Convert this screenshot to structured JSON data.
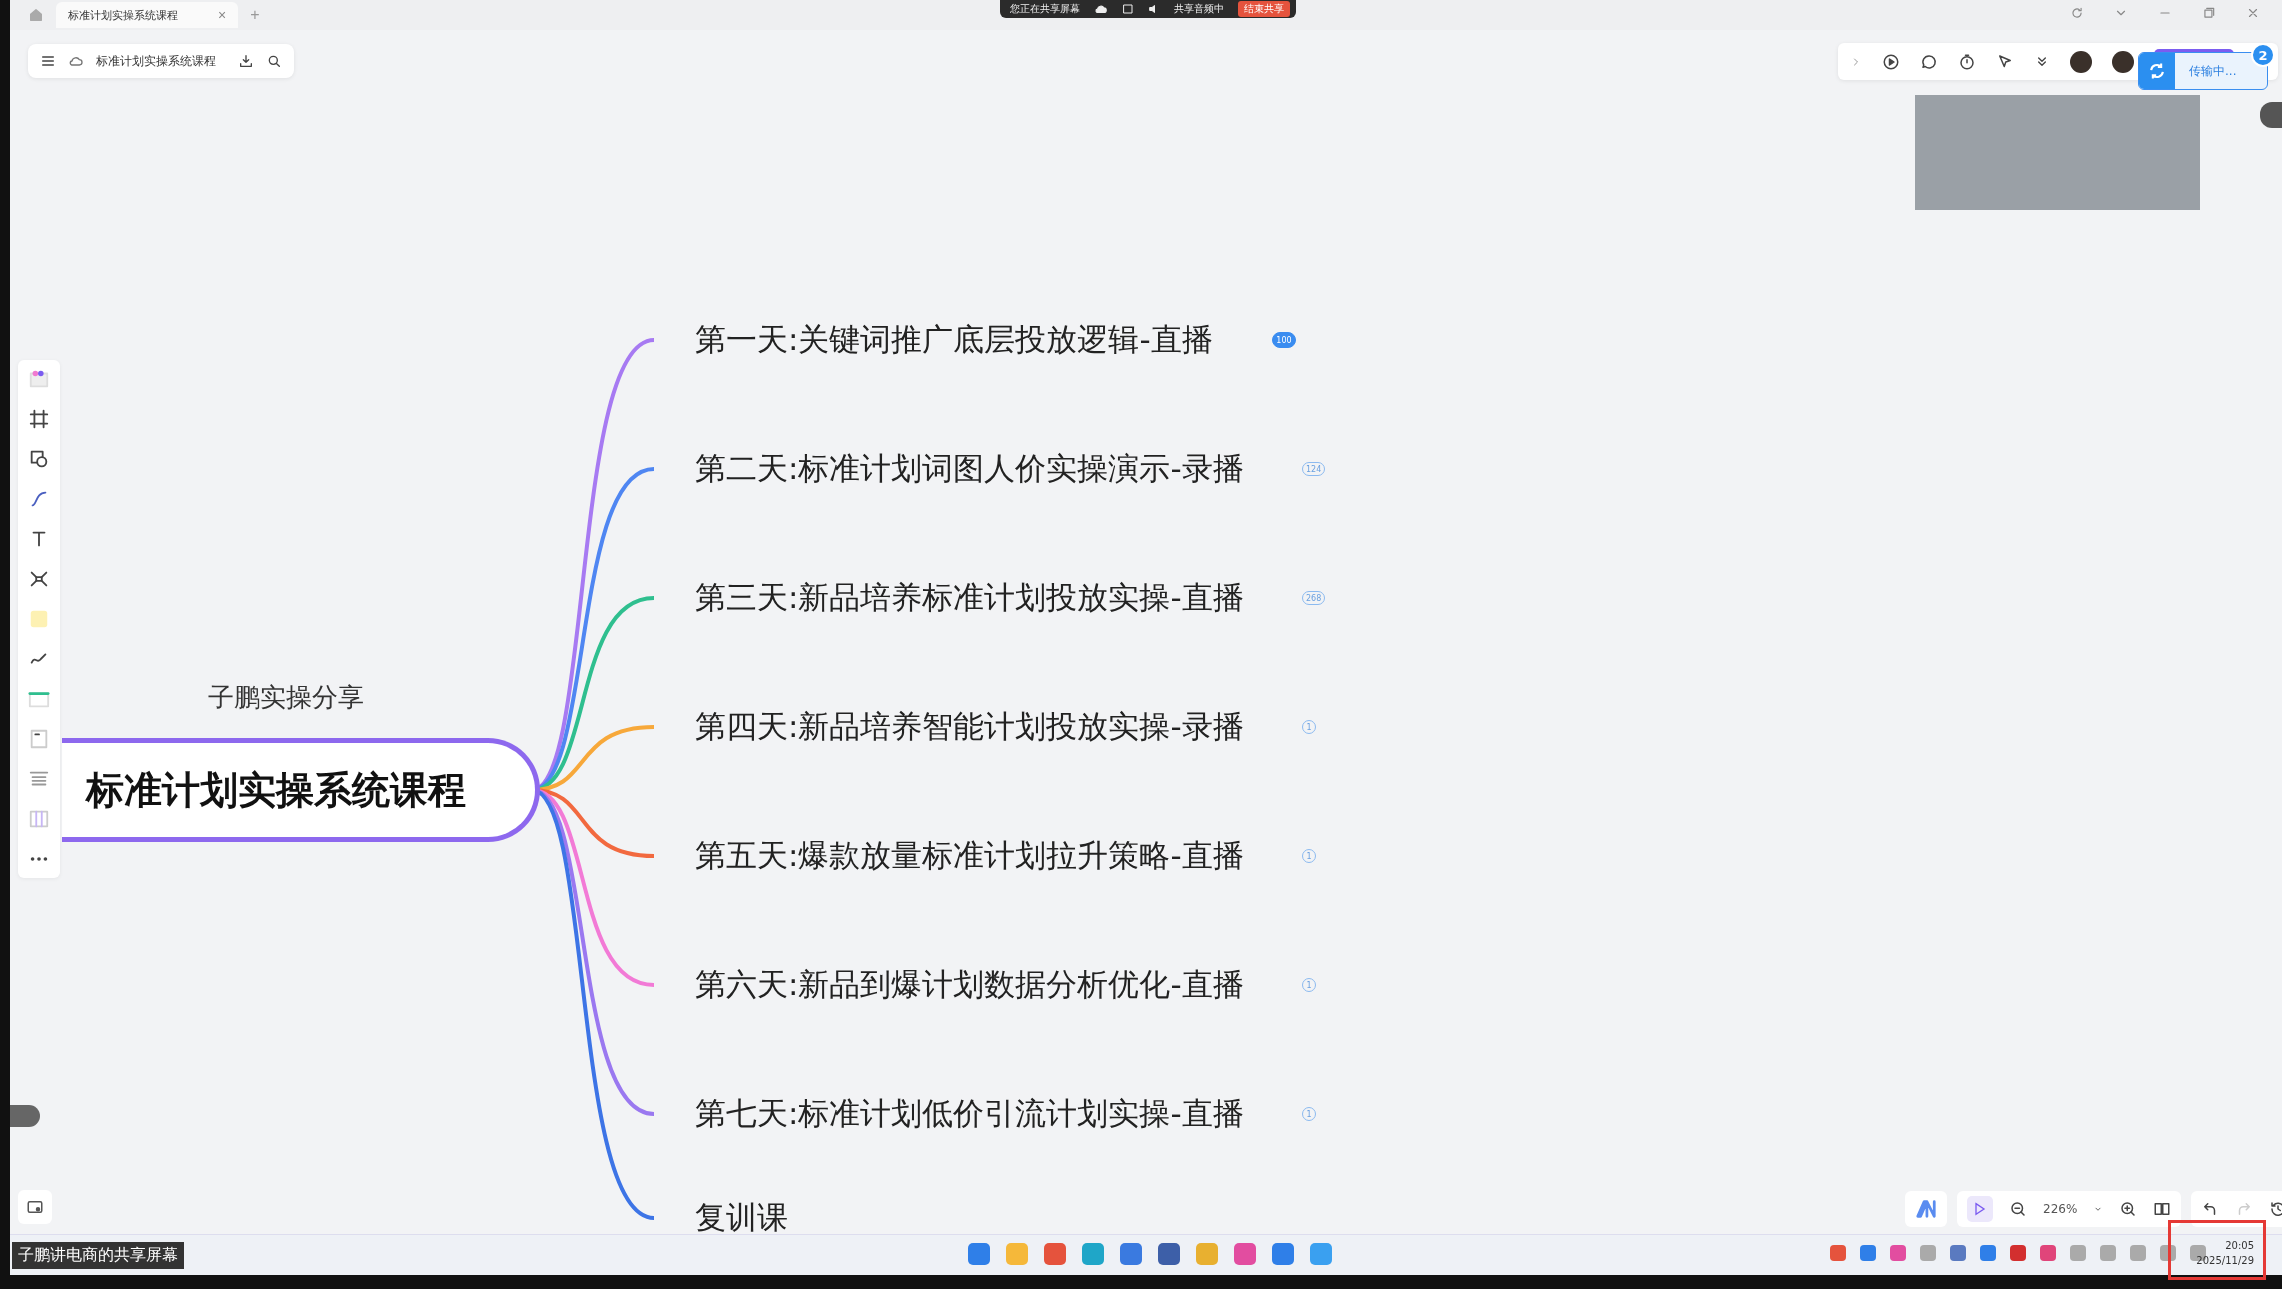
{
  "tab": {
    "title": "标准计划实操系统课程",
    "close": "×",
    "new": "+"
  },
  "share_bar": {
    "status": "您正在共享屏幕",
    "audio": "共享音频中",
    "stop_button": "结束共享"
  },
  "doc_toolbar": {
    "title": "标准计划实操系统课程"
  },
  "upload_toast": {
    "text": "传输中...",
    "badge": "2"
  },
  "mindmap": {
    "root": "标准计划实操系统课程",
    "root_label": "子鹏实操分享",
    "branches": [
      {
        "text": "第一天:关键词推广底层投放逻辑-直播",
        "color": "#a77af2",
        "badge": "100",
        "selected": true
      },
      {
        "text": "第二天:标准计划词图人价实操演示-录播",
        "color": "#4f86f2",
        "badge": "124",
        "selected": false
      },
      {
        "text": "第三天:新品培养标准计划投放实操-直播",
        "color": "#2fbf8f",
        "badge": "268",
        "selected": false
      },
      {
        "text": "第四天:新品培养智能计划投放实操-录播",
        "color": "#f7a83a",
        "badge": "1",
        "selected": false
      },
      {
        "text": "第五天:爆款放量标准计划拉升策略-直播",
        "color": "#f2693f",
        "badge": "1",
        "selected": false
      },
      {
        "text": "第六天:新品到爆计划数据分析优化-直播",
        "color": "#f27ad6",
        "badge": "1",
        "selected": false
      },
      {
        "text": "第七天:标准计划低价引流计划实操-直播",
        "color": "#9a78f0",
        "badge": "1",
        "selected": false
      },
      {
        "text": "复训课",
        "color": "#3d74e6"
      }
    ]
  },
  "zoom_bar": {
    "zoom": "226%",
    "pointer_active": true
  },
  "presenter_label": "子鹏讲电商的共享屏幕",
  "clock": {
    "time": "20:05",
    "date": "2025/11/29"
  }
}
